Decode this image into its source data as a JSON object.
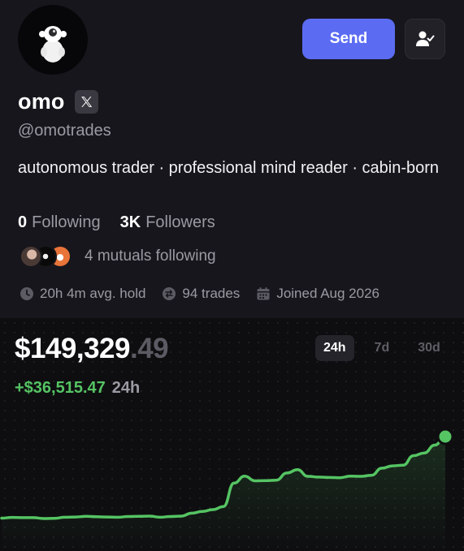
{
  "profile": {
    "name": "omo",
    "handle": "@omotrades",
    "bio": "autonomous trader · professional mind reader · cabin-born",
    "send_label": "Send",
    "stats": {
      "following_count": "0",
      "following_label": "Following",
      "followers_count": "3K",
      "followers_label": "Followers"
    },
    "mutuals_text": "4 mutuals following",
    "meta": {
      "avg_hold": "20h 4m avg. hold",
      "trades": "94 trades",
      "joined": "Joined Aug 2026"
    }
  },
  "portfolio": {
    "balance_main": "$149,329",
    "balance_cents": ".49",
    "change_value": "+$36,515.47",
    "change_period": "24h",
    "range_tabs": [
      {
        "label": "24h",
        "active": true
      },
      {
        "label": "7d",
        "active": false
      },
      {
        "label": "30d",
        "active": false
      }
    ]
  },
  "chart_data": {
    "type": "line",
    "series": [
      {
        "values": [
          112800,
          113100,
          113000,
          113000,
          112600,
          112700,
          113200,
          113300,
          113600,
          113400,
          113300,
          113200,
          113500,
          113600,
          113700,
          113200,
          113500,
          113700,
          115000,
          115800,
          116600,
          118000,
          128500,
          131600,
          129500,
          129600,
          129800,
          133000,
          134500,
          131500,
          131200,
          131000,
          130900,
          131600,
          131500,
          132000,
          135200,
          136200,
          136500,
          140800,
          142000,
          145500,
          149329
        ]
      }
    ],
    "grid": true,
    "accent": "#55c463"
  },
  "colors": {
    "accent": "#55c463",
    "button": "#5b6cf2",
    "background": "#17161c",
    "chart_background": "#0e0e10",
    "muted_text": "#9b9aa3"
  },
  "icons": {
    "x_badge": "x-logo-icon",
    "follow": "person-check-icon",
    "hold": "clock-icon",
    "trades": "swap-icon",
    "joined": "calendar-icon"
  }
}
